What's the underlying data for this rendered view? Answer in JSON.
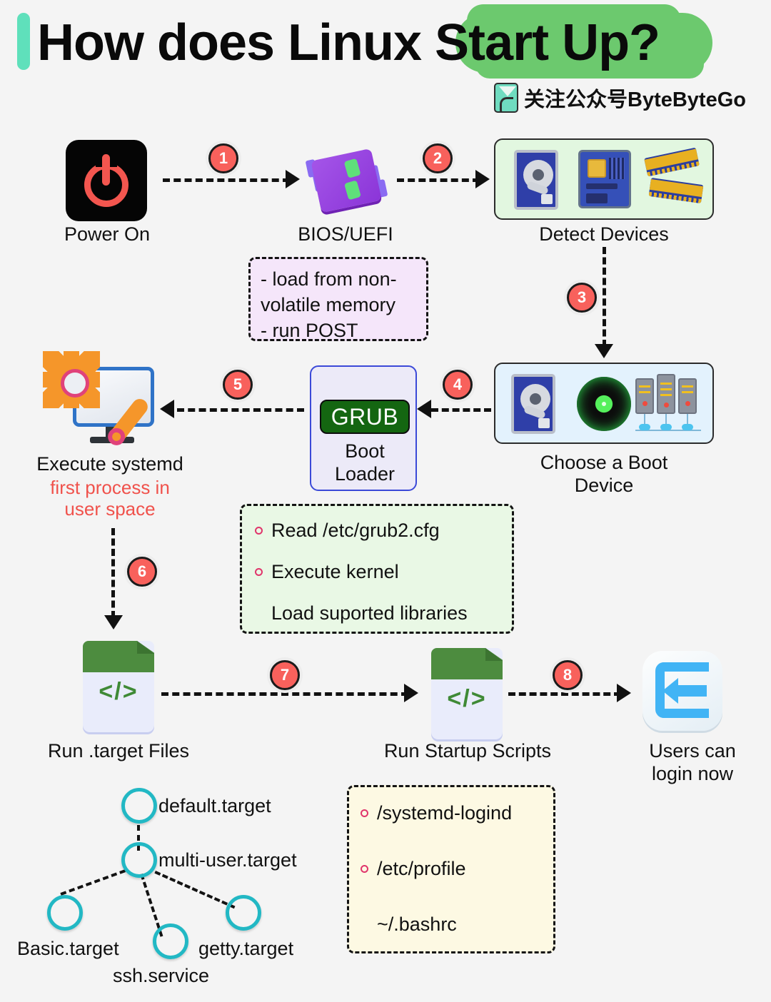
{
  "header": {
    "title_plain": "How does Linux ",
    "title_highlight": "Start Up?",
    "brand_text": "关注公众号ByteByteGo",
    "accent_bar_color": "#5fe0bb",
    "highlight_color": "#6cc96e"
  },
  "colors": {
    "background": "#f4f4f4",
    "badge": "#f8615c",
    "accent_red_text": "#f0524c",
    "grub_green": "#146611",
    "note_purple": "#f5e6fa",
    "note_green": "#e9f8e5",
    "note_yellow": "#fdf9e3",
    "devbox_green": "#e2f7e0",
    "devbox_blue": "#e3f2fd"
  },
  "steps": [
    {
      "number": "1",
      "from": "Power On",
      "to": "BIOS/UEFI"
    },
    {
      "number": "2",
      "from": "BIOS/UEFI",
      "to": "Detect Devices"
    },
    {
      "number": "3",
      "from": "Detect Devices",
      "to": "Choose a Boot Device"
    },
    {
      "number": "4",
      "from": "Choose a Boot Device",
      "to": "Boot Loader"
    },
    {
      "number": "5",
      "from": "Boot Loader",
      "to": "Execute systemd"
    },
    {
      "number": "6",
      "from": "Execute systemd",
      "to": "Run .target Files"
    },
    {
      "number": "7",
      "from": "Run .target Files",
      "to": "Run Startup Scripts"
    },
    {
      "number": "8",
      "from": "Run Startup Scripts",
      "to": "Users can login now"
    }
  ],
  "nodes": {
    "power_on": {
      "label": "Power On",
      "icon": "power-button-icon"
    },
    "bios": {
      "label": "BIOS/UEFI",
      "icon": "chip-icon"
    },
    "detect_devices": {
      "label": "Detect Devices",
      "icons": [
        "hard-drive-icon",
        "motherboard-icon",
        "ram-module-icon"
      ]
    },
    "choose_boot_device": {
      "label_line1": "Choose a Boot",
      "label_line2": "Device",
      "icons": [
        "hard-drive-icon",
        "optical-disc-icon",
        "server-rack-icon"
      ]
    },
    "boot_loader": {
      "chip_label": "GRUB",
      "label_line1": "Boot",
      "label_line2": "Loader"
    },
    "execute_systemd": {
      "label": "Execute systemd",
      "sub_line1": "first process in",
      "sub_line2": "user space",
      "icon": "monitor-gear-wrench-icon"
    },
    "run_target_files": {
      "label": "Run .target Files",
      "icon": "code-file-icon",
      "code_glyph": "</>"
    },
    "run_startup_scripts": {
      "label": "Run Startup Scripts",
      "icon": "code-file-icon",
      "code_glyph": "</>"
    },
    "users_login": {
      "label_line1": "Users can",
      "label_line2": "login now",
      "icon": "login-arrow-icon"
    }
  },
  "notes": {
    "bios_note": {
      "lines": [
        "- load from non-",
        "volatile memory",
        "- run POST"
      ]
    },
    "grub_note": {
      "items": [
        {
          "bullet": true,
          "text": "Read /etc/grub2.cfg"
        },
        {
          "bullet": true,
          "text": "Execute kernel"
        },
        {
          "bullet": false,
          "text": "Load suported libraries"
        }
      ]
    },
    "login_note": {
      "items": [
        {
          "bullet": true,
          "text": "/systemd-logind"
        },
        {
          "bullet": true,
          "text": "/etc/profile"
        },
        {
          "bullet": false,
          "text": "~/.bashrc"
        }
      ]
    }
  },
  "target_tree": {
    "nodes": [
      {
        "id": "default",
        "label": "default.target"
      },
      {
        "id": "multiuser",
        "label": "multi-user.target"
      },
      {
        "id": "basic",
        "label": "Basic.target"
      },
      {
        "id": "ssh",
        "label": "ssh.service"
      },
      {
        "id": "getty",
        "label": "getty.target"
      }
    ],
    "edges": [
      {
        "from": "default",
        "to": "multiuser"
      },
      {
        "from": "multiuser",
        "to": "basic"
      },
      {
        "from": "multiuser",
        "to": "ssh"
      },
      {
        "from": "multiuser",
        "to": "getty"
      }
    ]
  }
}
